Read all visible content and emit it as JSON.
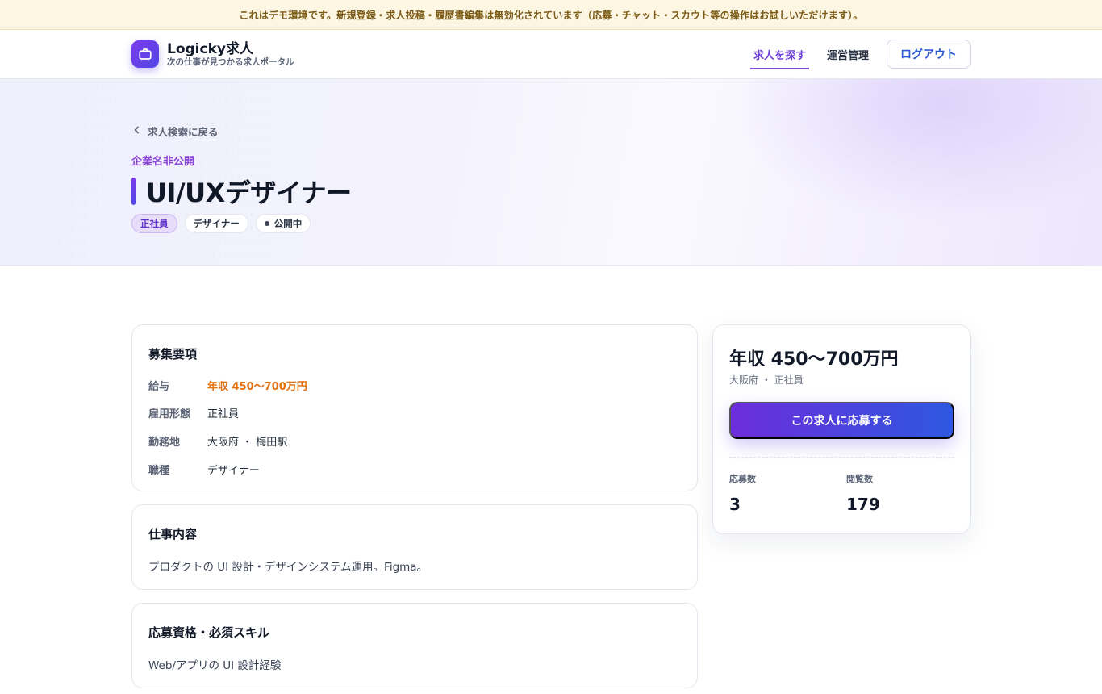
{
  "demo_banner": "これはデモ環境です。新規登録・求人投稿・履歴書編集は無効化されています（応募・チャット・スカウト等の操作はお試しいただけます）。",
  "brand": {
    "name": "Logicky求人",
    "tagline": "次の仕事が見つかる求人ポータル"
  },
  "nav": {
    "find_jobs": "求人を探す",
    "admin": "運営管理",
    "logout": "ログアウト"
  },
  "hero": {
    "back_label": "求人検索に戻る",
    "company": "企業名非公開",
    "title": "UI/UXデザイナー",
    "tags": [
      "正社員",
      "デザイナー",
      "公開中"
    ]
  },
  "requirements": {
    "title": "募集要項",
    "rows": [
      {
        "key": "給与",
        "value": "年収 450〜700万円"
      },
      {
        "key": "雇用形態",
        "value": "正社員"
      },
      {
        "key": "勤務地",
        "value": "大阪府 ・ 梅田駅"
      },
      {
        "key": "職種",
        "value": "デザイナー"
      }
    ]
  },
  "work": {
    "title": "仕事内容",
    "body": "プロダクトの UI 設計・デザインシステム運用。Figma。"
  },
  "skills": {
    "title": "応募資格・必須スキル",
    "body": "Web/アプリの UI 設計経験"
  },
  "side": {
    "salary": "年収 450〜700万円",
    "meta": "大阪府 ・ 正社員",
    "apply": "この求人に応募する",
    "applicants_label": "応募数",
    "applicants_value": "3",
    "views_label": "閲覧数",
    "views_value": "179"
  },
  "colors": {
    "accent": "#7c3aed",
    "salary": "#e3700f",
    "link": "#2f5bd1"
  }
}
